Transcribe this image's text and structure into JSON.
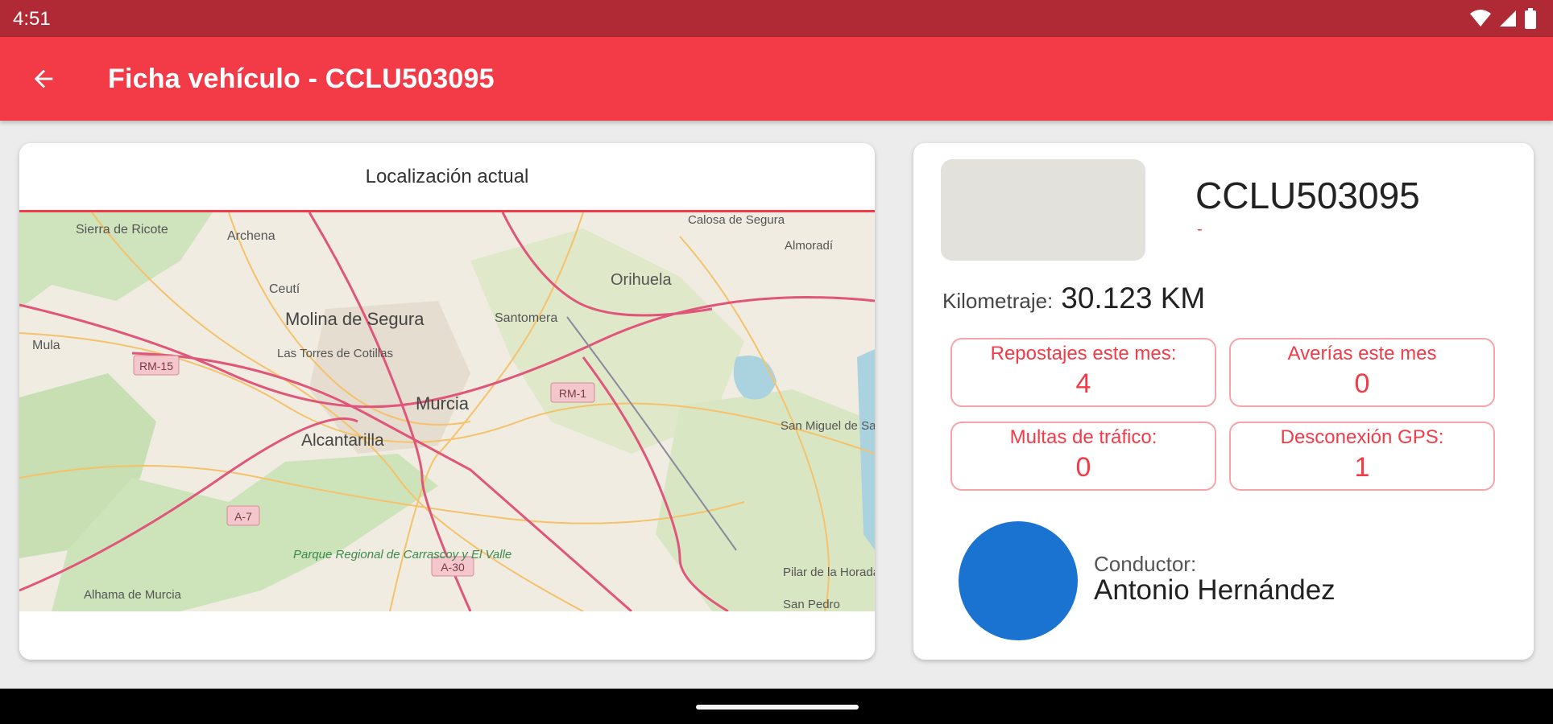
{
  "status_bar": {
    "time": "4:51",
    "icons": [
      "wifi-icon",
      "signal-icon",
      "battery-icon"
    ]
  },
  "app_bar": {
    "title": "Ficha vehículo - CCLU503095",
    "back_icon": "arrow-back-icon"
  },
  "colors": {
    "primary": "#f33b48",
    "status_bar": "#b02a35",
    "avatar": "#1a73d1",
    "stat_border": "#f6a3aa"
  },
  "map_card": {
    "header": "Localización actual",
    "map_labels": [
      "Sierra de Ricote",
      "Archena",
      "Calosa de Segura",
      "Almoradí",
      "Ceutí",
      "Orihuela",
      "Molina de Segura",
      "Santomera",
      "Mula",
      "Las Torres de Cotillas",
      "RM-15",
      "RM-1",
      "Murcia",
      "San Miguel de Salinas",
      "Alcantarilla",
      "A-7",
      "Parque Regional de Carrascoy y El Valle",
      "A-30",
      "Pilar de la Horadada",
      "Alhama de Murcia",
      "San Pedro"
    ]
  },
  "vehicle": {
    "plate": "CCLU503095",
    "subtitle": "-"
  },
  "mileage": {
    "label": "Kilometraje:",
    "value": "30.123 KM"
  },
  "stats": [
    {
      "label": "Repostajes este mes:",
      "value": "4"
    },
    {
      "label": "Averías este mes",
      "value": "0"
    },
    {
      "label": "Multas de tráfico:",
      "value": "0"
    },
    {
      "label": "Desconexión GPS:",
      "value": "1"
    }
  ],
  "driver": {
    "label": "Conductor:",
    "name": "Antonio Hernández"
  }
}
